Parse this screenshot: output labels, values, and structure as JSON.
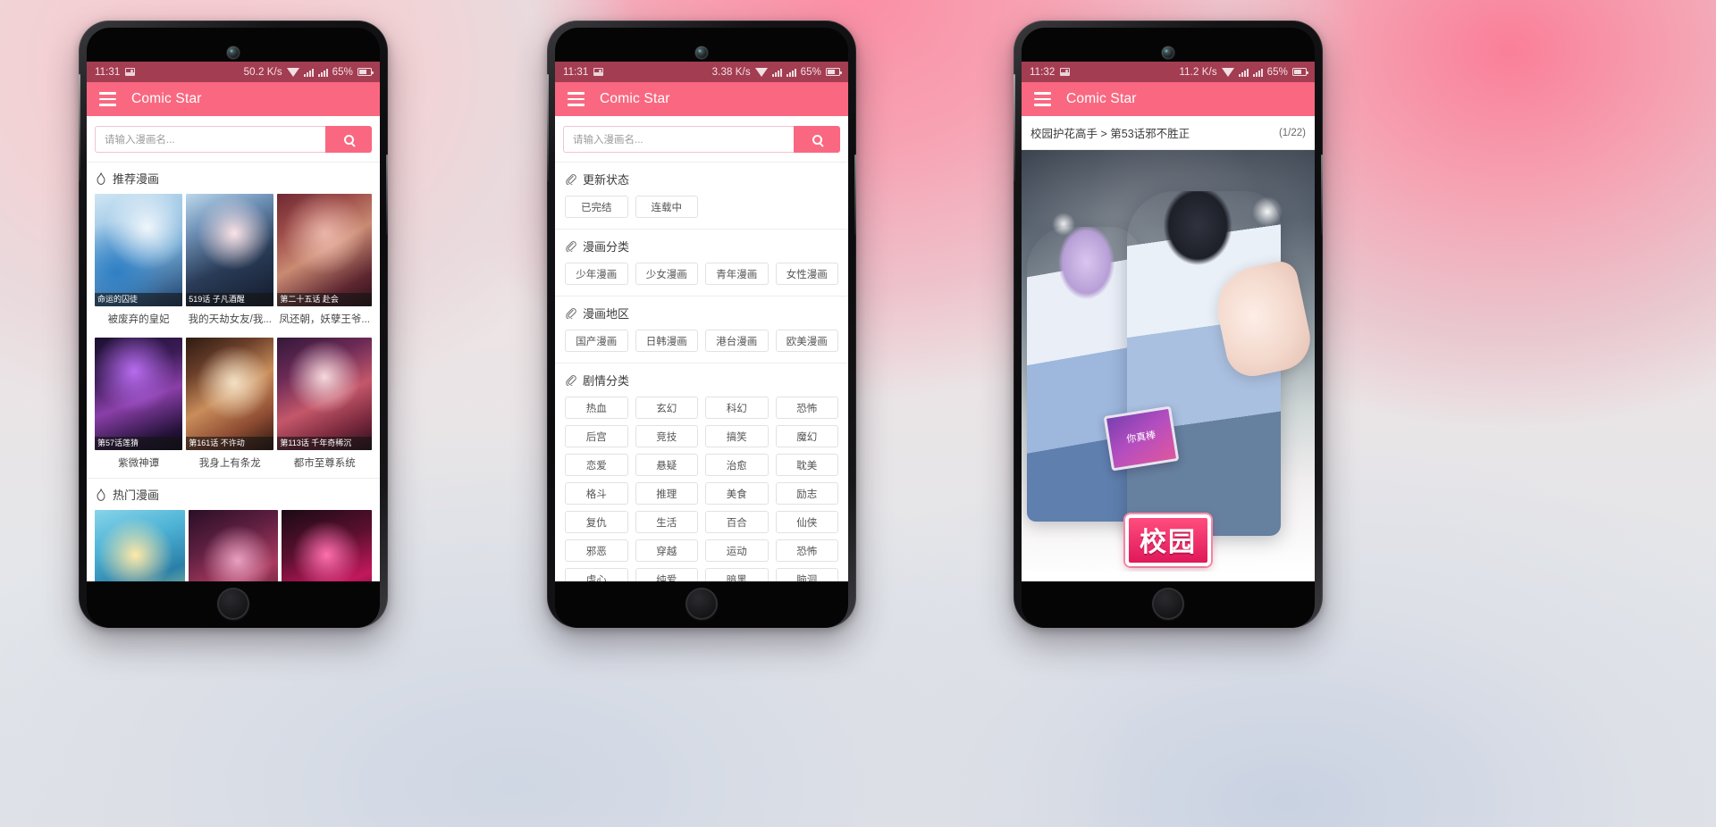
{
  "app": {
    "title": "Comic Star",
    "accent": "#f96880",
    "statusbar_bg": "#a33d52"
  },
  "phones": [
    {
      "status": {
        "time": "11:31",
        "net_speed": "50.2 K/s",
        "battery": "65%"
      },
      "search": {
        "placeholder": "请输入漫画名...",
        "value": ""
      },
      "sections": [
        {
          "title": "推荐漫画",
          "cards": [
            {
              "badge": "命运的囚徒",
              "title": "被废弃的皇妃",
              "art": "art1"
            },
            {
              "badge": "519话 子凡酒醒",
              "title": "我的天劫女友/我...",
              "art": "art2"
            },
            {
              "badge": "第二十五话 赴会",
              "title": "凤还朝，妖孽王爷...",
              "art": "art3"
            },
            {
              "badge": "第57话莲猜",
              "title": "紫微神谭",
              "art": "art4"
            },
            {
              "badge": "第161话 不许动",
              "title": "我身上有条龙",
              "art": "art5"
            },
            {
              "badge": "第113话 千年奇稀沉",
              "title": "都市至尊系统",
              "art": "art6"
            }
          ]
        },
        {
          "title": "热门漫画",
          "cards": [
            {
              "badge": "",
              "title": "",
              "art": "art7"
            },
            {
              "badge": "",
              "title": "",
              "art": "art8"
            },
            {
              "badge": "",
              "title": "",
              "art": "art9"
            }
          ]
        }
      ]
    },
    {
      "status": {
        "time": "11:31",
        "net_speed": "3.38 K/s",
        "battery": "65%"
      },
      "search": {
        "placeholder": "请输入漫画名...",
        "value": ""
      },
      "filters": [
        {
          "title": "更新状态",
          "chips": [
            "已完结",
            "连载中"
          ]
        },
        {
          "title": "漫画分类",
          "chips": [
            "少年漫画",
            "少女漫画",
            "青年漫画",
            "女性漫画"
          ]
        },
        {
          "title": "漫画地区",
          "chips": [
            "国产漫画",
            "日韩漫画",
            "港台漫画",
            "欧美漫画"
          ]
        },
        {
          "title": "剧情分类",
          "chips": [
            "热血",
            "玄幻",
            "科幻",
            "恐怖",
            "后宫",
            "竞技",
            "搞笑",
            "魔幻",
            "恋爱",
            "悬疑",
            "治愈",
            "耽美",
            "格斗",
            "推理",
            "美食",
            "励志",
            "复仇",
            "生活",
            "百合",
            "仙侠",
            "邪恶",
            "穿越",
            "运动",
            "恐怖",
            "虐心",
            "纯爱",
            "暗黑",
            "脑洞"
          ]
        }
      ]
    },
    {
      "status": {
        "time": "11:32",
        "net_speed": "11.2 K/s",
        "battery": "65%"
      },
      "reader": {
        "title": "校园护花高手 > 第53话邪不胜正",
        "page_indicator": "(1/22)",
        "tablet_text": "你真棒",
        "logo_text": "校园"
      }
    }
  ],
  "icons": {
    "hamburger": "hamburger-icon",
    "search": "search-icon",
    "flame": "flame-icon",
    "clip": "paperclip-icon",
    "wifi": "wifi-icon",
    "battery": "battery-icon",
    "picture": "picture-icon"
  }
}
